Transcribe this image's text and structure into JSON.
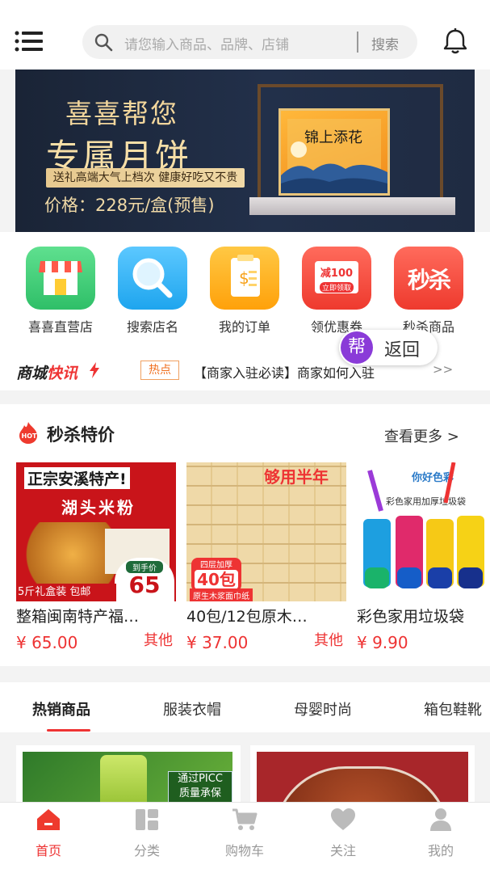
{
  "header": {
    "search_placeholder": "请您输入商品、品牌、店铺",
    "search_button": "搜索"
  },
  "banner": {
    "title_line1": "喜喜帮您",
    "title_line2": "专属月饼",
    "subtitle": "送礼高端大气上档次 健康好吃又不贵",
    "price": "价格：228元/盒(预售)",
    "box_text": "锦上添花"
  },
  "quick_menu": [
    {
      "label": "喜喜直营店",
      "icon": "store-icon",
      "color": "#3fcf78"
    },
    {
      "label": "搜索店名",
      "icon": "magnifier-icon",
      "color": "#33b6f2"
    },
    {
      "label": "我的订单",
      "icon": "order-icon",
      "color": "#ffb321"
    },
    {
      "label": "领优惠券",
      "icon": "coupon-icon",
      "color": "#f04a3e"
    },
    {
      "label": "秒杀商品",
      "icon": "flash-sale-icon",
      "color": "#f04a3e"
    }
  ],
  "quick_menu_extra": {
    "coupon_badge": "减100",
    "coupon_sub": "立即领取",
    "flash_badge": "秒杀"
  },
  "news": {
    "logo_part1": "商城",
    "logo_part2": "快讯",
    "tag": "热点",
    "text": "【商家入驻必读】商家如何入驻",
    "more": ">>"
  },
  "back_button": {
    "badge": "帮",
    "label": "返回"
  },
  "flash_sale": {
    "title": "秒杀特价",
    "more": "查看更多 >",
    "products": [
      {
        "name": "整箱闽南特产福…",
        "price": "¥ 65.00",
        "tag": "其他",
        "img_text1": "正宗安溪特产!",
        "img_text2": "湖头米粉",
        "img_badge": "65",
        "img_badge_label": "到手价",
        "img_strip": "5斤礼盒装 包邮"
      },
      {
        "name": "40包/12包原木…",
        "price": "¥ 37.00",
        "tag": "其他",
        "img_text1": "够用半年",
        "img_badge": "40包",
        "img_badge_label": "四层加厚",
        "img_strip": "原生木浆面巾纸"
      },
      {
        "name": "彩色家用垃圾袋",
        "price": "¥ 9.90",
        "tag": "",
        "img_text1": "你好色彩",
        "img_text2": "彩色家用加厚垃圾袋"
      }
    ]
  },
  "tabs": [
    "热销商品",
    "服装衣帽",
    "母婴时尚",
    "箱包鞋靴"
  ],
  "goods_preview": {
    "card1_text1": "通过PICC",
    "card1_text2": "质量承保"
  },
  "bottom_nav": [
    {
      "label": "首页",
      "icon": "home-icon",
      "active": true
    },
    {
      "label": "分类",
      "icon": "category-icon",
      "active": false
    },
    {
      "label": "购物车",
      "icon": "cart-icon",
      "active": false
    },
    {
      "label": "关注",
      "icon": "heart-icon",
      "active": false
    },
    {
      "label": "我的",
      "icon": "user-icon",
      "active": false
    }
  ],
  "colors": {
    "accent": "#e33333",
    "blue_dot": "#2b8cff",
    "back_badge": "#8a3bd8"
  }
}
